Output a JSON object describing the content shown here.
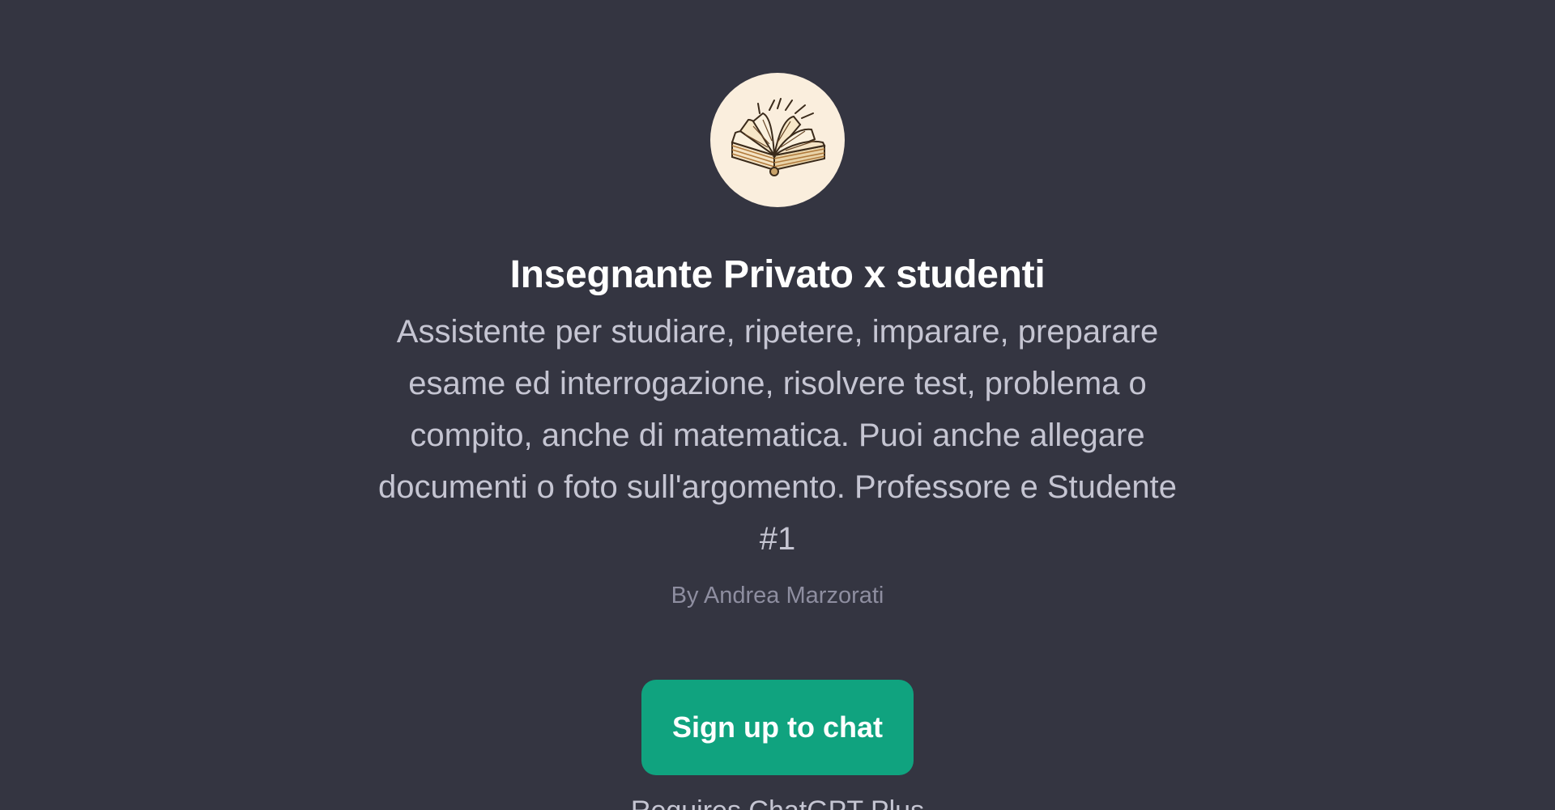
{
  "gpt": {
    "avatar_icon": "open-book-icon",
    "title": "Insegnante Privato x studenti",
    "description": "Assistente per studiare, ripetere, imparare, preparare esame ed interrogazione, risolvere test, problema o compito, anche di matematica. Puoi anche allegare documenti o foto sull'argomento. Professore e Studente #1",
    "author": "By Andrea Marzorati"
  },
  "cta": {
    "label": "Sign up to chat"
  },
  "footer": {
    "text": "Requires ChatGPT Plus"
  },
  "colors": {
    "background": "#343541",
    "accent": "#10a37f",
    "avatar_background": "#faeedd"
  }
}
